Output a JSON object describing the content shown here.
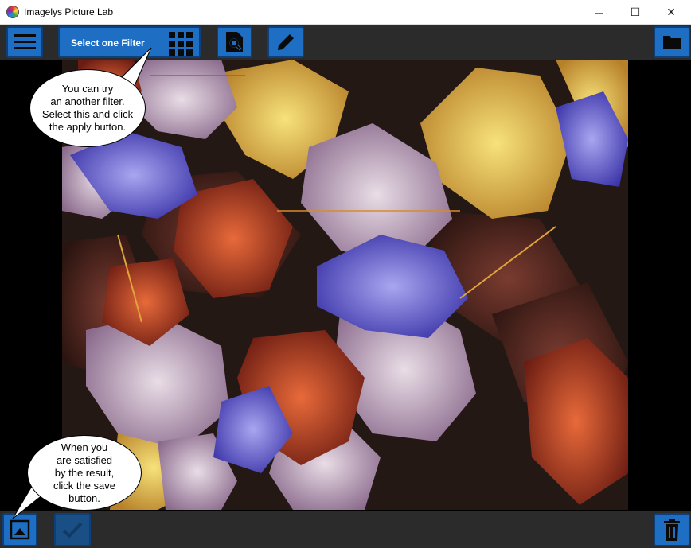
{
  "window": {
    "title": "Imagelys Picture Lab",
    "minimize": "─",
    "maximize": "☐",
    "close": "✕"
  },
  "toolbar": {
    "filter_select_label": "Select one Filter"
  },
  "tooltips": {
    "filter_tip": [
      "You can try",
      "an another filter.",
      "Select this and click",
      "the apply button."
    ],
    "save_tip": [
      "When you",
      "are satisfied",
      "by the result,",
      "click the save",
      "button."
    ]
  },
  "colors": {
    "button_blue": "#1e6fc4",
    "bar_dark": "#2b2b2b"
  },
  "icons": [
    "menu-icon",
    "grid-icon",
    "preview-search-icon",
    "pencil-icon",
    "folder-icon",
    "save-image-icon",
    "checkmark-icon",
    "trash-icon"
  ]
}
